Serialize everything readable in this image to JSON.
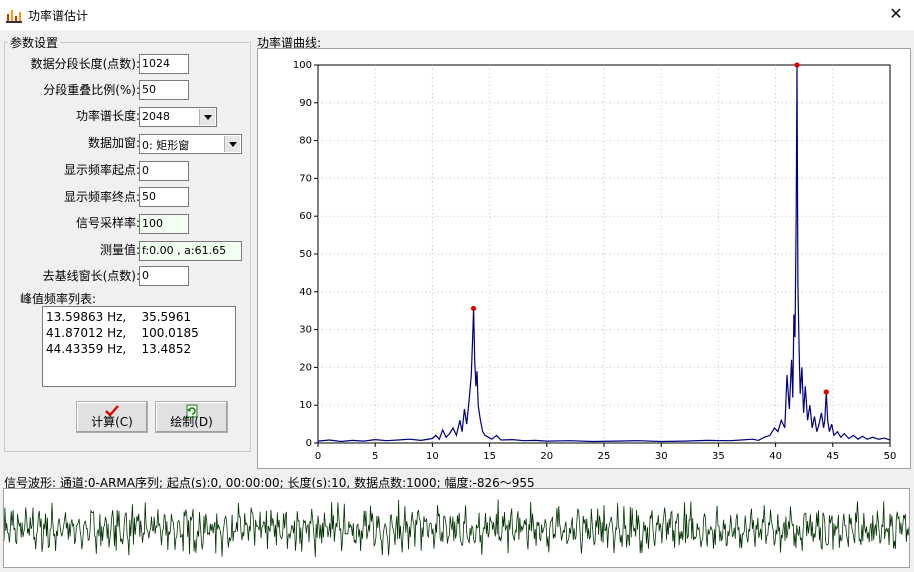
{
  "window": {
    "title": "功率谱估计",
    "app_icon": "chart-icon",
    "close_icon": "close-icon"
  },
  "params": {
    "group_title": "参数设置",
    "fields": [
      {
        "label": "数据分段长度(点数):",
        "value": "1024"
      },
      {
        "label": "分段重叠比例(%):",
        "value": "50"
      },
      {
        "label": "功率谱长度:",
        "value": "2048"
      },
      {
        "label": "数据加窗:",
        "value": "0: 矩形窗"
      },
      {
        "label": "显示频率起点:",
        "value": "0"
      },
      {
        "label": "显示频率终点:",
        "value": "50"
      },
      {
        "label": "信号采样率:",
        "value": "100"
      },
      {
        "label": "测量值:",
        "value": "f:0.00 , a:61.65"
      },
      {
        "label": "去基线窗长(点数):",
        "value": "0"
      }
    ],
    "peak_list_label": "峰值频率列表:",
    "peak_list": "13.59863 Hz,    35.5961\n41.87012 Hz,    100.0185\n44.43359 Hz,    13.4852"
  },
  "buttons": {
    "calc_label": "计算(C)",
    "calc_icon": "checkmark-icon",
    "draw_label": "绘制(D)",
    "draw_icon": "refresh-icon"
  },
  "spectrum": {
    "section_label": "功率谱曲线:"
  },
  "waveform": {
    "info": "信号波形: 通道:0-ARMA序列; 起点(s):0,  00:00:00; 长度(s):10, 数据点数:1000; 幅度:-826～955"
  },
  "colors": {
    "spectrum_line": "#000080",
    "peak_marker": "#e00000",
    "waveform_line": "#003300",
    "grid": "#c0c0c0"
  },
  "chart_data": [
    {
      "type": "line",
      "xlim": [
        0,
        50
      ],
      "ylim": [
        0,
        100
      ],
      "x_ticks": [
        0,
        5,
        10,
        15,
        20,
        25,
        30,
        35,
        40,
        45,
        50
      ],
      "y_ticks": [
        0,
        10,
        20,
        30,
        40,
        50,
        60,
        70,
        80,
        90,
        100
      ],
      "grid": true,
      "peaks": [
        {
          "x": 13.59863,
          "y": 35.5961
        },
        {
          "x": 41.87012,
          "y": 100.0185
        },
        {
          "x": 44.43359,
          "y": 13.4852
        }
      ],
      "series": [
        {
          "x": [
            0,
            1,
            2,
            3,
            4,
            5,
            6,
            7,
            8,
            9,
            10,
            10.3,
            10.6,
            10.9,
            11.2,
            11.5,
            11.8,
            12.1,
            12.4,
            12.6,
            12.8,
            13.0,
            13.2,
            13.4,
            13.5,
            13.6,
            13.7,
            13.8,
            13.9,
            14.0,
            14.2,
            14.4,
            14.6,
            14.9,
            15.2,
            15.6,
            16.0,
            17,
            18,
            19,
            20,
            22,
            24,
            26,
            28,
            30,
            32,
            34,
            36,
            37,
            38,
            38.5,
            39,
            39.5,
            39.9,
            40.2,
            40.5,
            40.8,
            41.0,
            41.2,
            41.4,
            41.5,
            41.6,
            41.7,
            41.8,
            41.87,
            41.95,
            42.05,
            42.15,
            42.3,
            42.45,
            42.6,
            42.8,
            43.0,
            43.2,
            43.4,
            43.6,
            43.8,
            44.0,
            44.2,
            44.3,
            44.43,
            44.55,
            44.7,
            44.9,
            45.1,
            45.4,
            45.7,
            46.0,
            46.4,
            46.8,
            47.2,
            47.6,
            48.0,
            48.5,
            49.0,
            49.5,
            50
          ],
          "y": [
            0.5,
            0.8,
            0.4,
            0.7,
            0.5,
            0.9,
            0.6,
            0.8,
            1.0,
            0.7,
            1.2,
            2.0,
            1.0,
            3.5,
            1.5,
            2.5,
            4.0,
            2.0,
            6.0,
            3.0,
            9.0,
            5.0,
            11.0,
            18.0,
            26.0,
            35.6,
            22.0,
            15.0,
            19.0,
            10.0,
            6.0,
            3.0,
            2.0,
            1.5,
            1.0,
            2.0,
            0.8,
            0.9,
            0.6,
            0.7,
            0.5,
            0.6,
            0.4,
            0.5,
            0.6,
            0.4,
            0.5,
            0.7,
            0.6,
            0.8,
            1.0,
            0.7,
            1.5,
            2.0,
            4.0,
            3.0,
            6.0,
            4.0,
            18.0,
            9.0,
            22.0,
            12.0,
            34.0,
            28.0,
            60.0,
            100.0,
            42.0,
            25.0,
            13.0,
            20.0,
            8.0,
            15.0,
            6.0,
            10.0,
            4.0,
            7.0,
            3.0,
            5.0,
            8.0,
            4.0,
            6.0,
            13.5,
            6.0,
            3.0,
            5.0,
            2.0,
            3.0,
            1.5,
            2.5,
            1.2,
            2.0,
            1.0,
            1.8,
            1.0,
            1.5,
            1.0,
            1.3,
            0.8
          ]
        }
      ]
    },
    {
      "type": "line",
      "ylim": [
        -826,
        955
      ]
    }
  ]
}
